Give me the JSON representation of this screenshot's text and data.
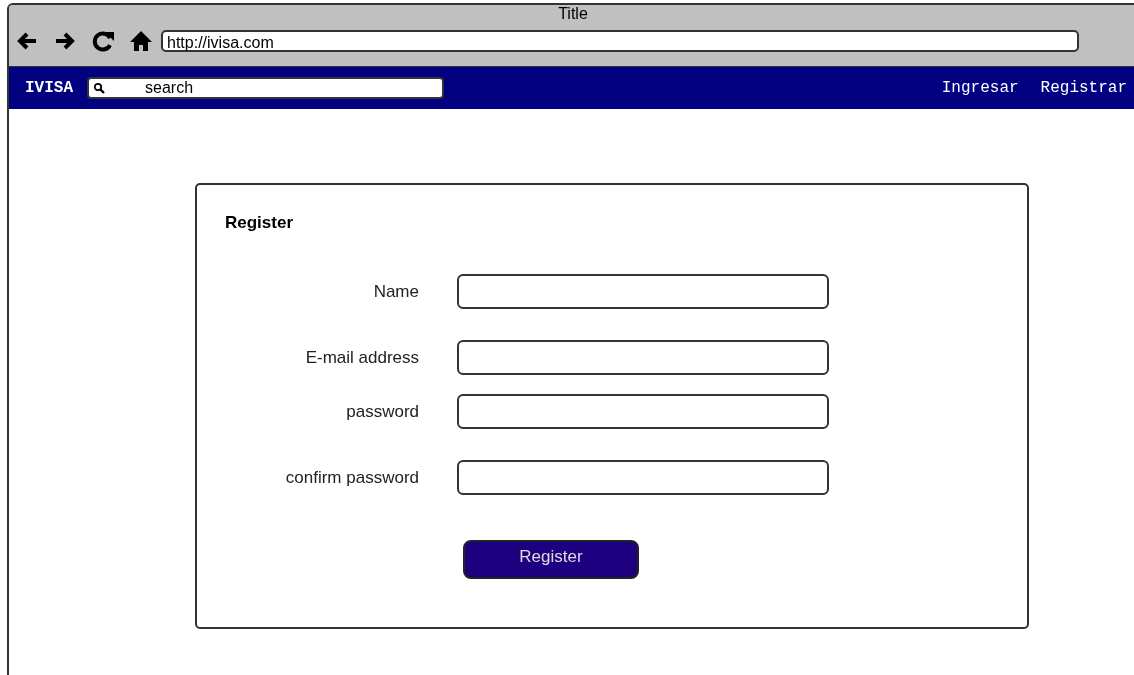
{
  "window": {
    "title": "Title"
  },
  "browser": {
    "url": "http://ivisa.com"
  },
  "navbar": {
    "brand": "IVISA",
    "search": {
      "placeholder": "search"
    },
    "links": [
      {
        "label": "Ingresar"
      },
      {
        "label": "Registrar"
      }
    ]
  },
  "form": {
    "title": "Register",
    "fields": [
      {
        "label": "Name"
      },
      {
        "label": "E-mail address"
      },
      {
        "label": "password"
      },
      {
        "label": "confirm password"
      }
    ],
    "submit": "Register"
  }
}
